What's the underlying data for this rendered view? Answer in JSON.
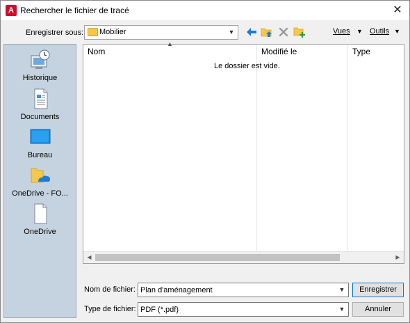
{
  "window": {
    "title": "Rechercher le fichier de tracé"
  },
  "toolbar": {
    "save_in_label": "Enregistrer sous:",
    "current_folder": "Mobilier",
    "views_label": "Vues",
    "tools_label": "Outils"
  },
  "places": [
    {
      "label": "Historique",
      "icon": "history-icon"
    },
    {
      "label": "Documents",
      "icon": "documents-icon"
    },
    {
      "label": "Bureau",
      "icon": "desktop-icon"
    },
    {
      "label": "OneDrive - FO...",
      "icon": "onedrive-folder-icon"
    },
    {
      "label": "OneDrive",
      "icon": "onedrive-file-icon"
    }
  ],
  "filelist": {
    "columns": [
      "Nom",
      "Modifié le",
      "Type"
    ],
    "empty_message": "Le dossier est vide."
  },
  "form": {
    "filename_label": "Nom de fichier:",
    "filename_value": "Plan d'aménagement",
    "filetype_label": "Type de fichier:",
    "filetype_value": "PDF (*.pdf)",
    "save_button": "Enregistrer",
    "cancel_button": "Annuler"
  },
  "colors": {
    "places_bg": "#c5d2df",
    "app_icon": "#c8102e",
    "back_arrow": "#1e7bd6",
    "folder": "#f5c84b"
  }
}
